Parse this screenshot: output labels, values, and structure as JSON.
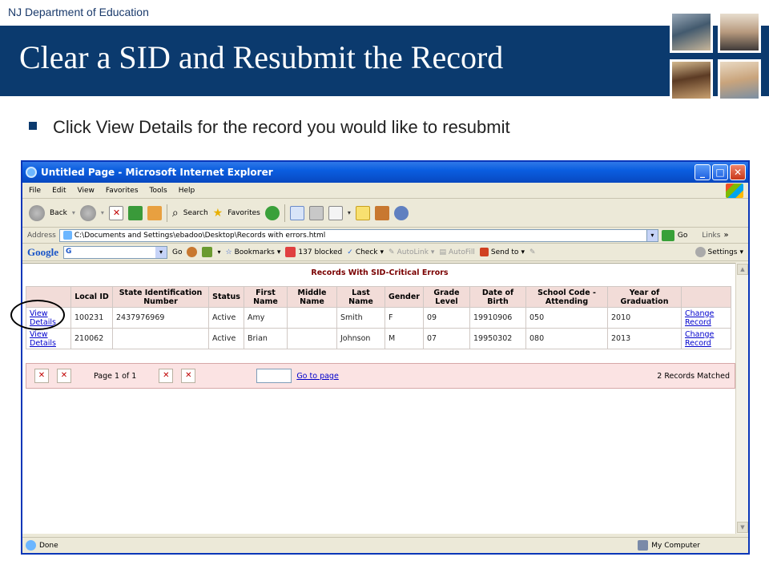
{
  "slide": {
    "org": "NJ Department of Education",
    "title": "Clear a SID and Resubmit the Record",
    "bullet": "Click View Details for the record you would like to resubmit"
  },
  "browser": {
    "window_title": "Untitled Page - Microsoft Internet Explorer",
    "menu": [
      "File",
      "Edit",
      "View",
      "Favorites",
      "Tools",
      "Help"
    ],
    "toolbar": {
      "back": "Back",
      "search": "Search",
      "favorites": "Favorites"
    },
    "address": {
      "label": "Address",
      "value": "C:\\Documents and Settings\\ebadoo\\Desktop\\Records with errors.html",
      "go": "Go",
      "links": "Links"
    },
    "google_bar": {
      "logo": "Google",
      "go": "Go",
      "bookmarks": "Bookmarks",
      "blocked": "137 blocked",
      "check": "Check",
      "autolink": "AutoLink",
      "autofill": "AutoFill",
      "send_to": "Send to",
      "settings": "Settings"
    },
    "status": {
      "left": "Done",
      "right": "My Computer"
    }
  },
  "grid": {
    "title": "Records With SID-Critical Errors",
    "headers": [
      "",
      "Local ID",
      "State Identification Number",
      "Status",
      "First Name",
      "Middle Name",
      "Last Name",
      "Gender",
      "Grade Level",
      "Date of Birth",
      "School Code - Attending",
      "Year of Graduation",
      ""
    ],
    "rows": [
      {
        "view": "View Details",
        "local_id": "100231",
        "sid": "2437976969",
        "status": "Active",
        "first": "Amy",
        "middle": "",
        "last": "Smith",
        "gender": "F",
        "grade": "09",
        "dob": "19910906",
        "school": "050",
        "grad_year": "2010",
        "change": "Change Record"
      },
      {
        "view": "View Details",
        "local_id": "210062",
        "sid": "",
        "status": "Active",
        "first": "Brian",
        "middle": "",
        "last": "Johnson",
        "gender": "M",
        "grade": "07",
        "dob": "19950302",
        "school": "080",
        "grad_year": "2013",
        "change": "Change Record"
      }
    ],
    "pager": {
      "page": "Page 1 of 1",
      "goto": "Go to page",
      "matched": "2 Records Matched"
    }
  }
}
